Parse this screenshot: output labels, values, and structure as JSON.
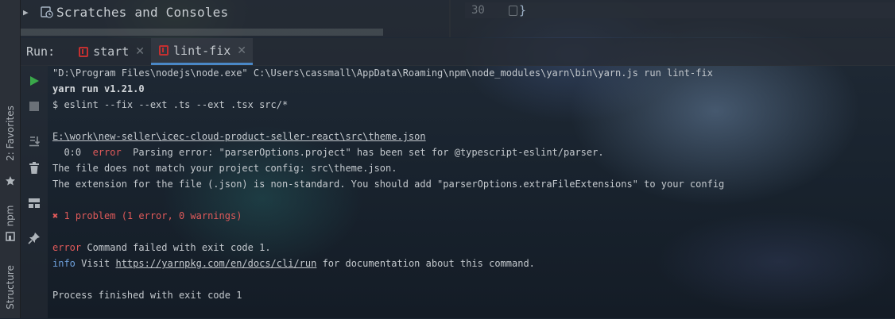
{
  "project_tree": {
    "item_label": "Scratches and Consoles"
  },
  "editor": {
    "line_number": "30",
    "code": "}"
  },
  "run_panel": {
    "label": "Run:",
    "tabs": [
      {
        "label": "start",
        "active": false
      },
      {
        "label": "lint-fix",
        "active": true
      }
    ]
  },
  "side_tabs": {
    "favorites": "2: Favorites",
    "npm": "npm",
    "structure": "Structure"
  },
  "console": {
    "cmd_line": "\"D:\\Program Files\\nodejs\\node.exe\" C:\\Users\\cassmall\\AppData\\Roaming\\npm\\node_modules\\yarn\\bin\\yarn.js run lint-fix",
    "yarn_version": "yarn run v1.21.0",
    "eslint_cmd": "$ eslint --fix --ext .ts --ext .tsx src/*",
    "file_path": "E:\\work\\new-seller\\icec-cloud-product-seller-react\\src\\theme.json",
    "err_pos": "  0:0  ",
    "err_word": "error",
    "err_msg": "  Parsing error: \"parserOptions.project\" has been set for @typescript-eslint/parser.",
    "mismatch": "The file does not match your project config: src\\theme.json.",
    "extension": "The extension for the file (.json) is non-standard. You should add \"parserOptions.extraFileExtensions\" to your config",
    "problem_icon": "✖",
    "problem": " 1 problem (1 error, 0 warnings)",
    "fail_prefix": "error",
    "fail_msg": " Command failed with exit code 1.",
    "info_prefix": "info",
    "info_visit": " Visit ",
    "info_url": "https://yarnpkg.com/en/docs/cli/run",
    "info_rest": " for documentation about this command.",
    "finished": "Process finished with exit code 1"
  },
  "colors": {
    "error_red": "#e05a5a",
    "info_blue": "#6ea0dc",
    "run_green": "#3aa84a",
    "tab_accent": "#4a88c7"
  }
}
